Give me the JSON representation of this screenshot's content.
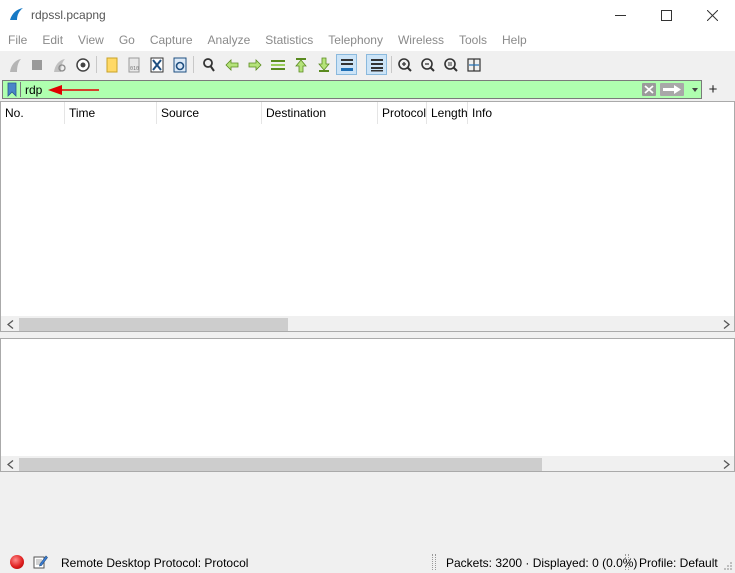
{
  "window": {
    "title": "rdpssl.pcapng",
    "minimize_icon": "minimize-icon",
    "maximize_icon": "maximize-icon",
    "close_icon": "close-icon"
  },
  "menu": {
    "items": [
      "File",
      "Edit",
      "View",
      "Go",
      "Capture",
      "Analyze",
      "Statistics",
      "Telephony",
      "Wireless",
      "Tools",
      "Help"
    ]
  },
  "toolbar": {
    "icons": [
      "start-capture-icon",
      "stop-capture-icon",
      "restart-capture-icon",
      "capture-options-icon",
      "open-file-icon",
      "save-file-icon",
      "close-file-icon",
      "reload-file-icon",
      "find-packet-icon",
      "go-back-icon",
      "go-forward-icon",
      "go-to-packet-icon",
      "go-first-icon",
      "go-last-icon",
      "autoscroll-icon",
      "colorize-icon",
      "zoom-in-icon",
      "zoom-out-icon",
      "normal-size-icon",
      "resize-columns-icon"
    ]
  },
  "filter": {
    "value": "rdp",
    "background_color": "#afffaf",
    "bookmark_icon": "bookmark-icon",
    "clear_icon": "clear-filter-icon",
    "apply_icon": "apply-filter-arrow-icon",
    "dropdown_icon": "chevron-down-icon",
    "add_label": "+"
  },
  "annotation": {
    "arrow_color": "#e00000"
  },
  "packet_list": {
    "columns": [
      "No.",
      "Time",
      "Source",
      "Destination",
      "Protocol",
      "Length",
      "Info"
    ],
    "rows": []
  },
  "statusbar": {
    "protocol_text": "Remote Desktop Protocol: Protocol",
    "packets_text": "Packets: 3200 · Displayed: 0 (0.0%)",
    "profile_text": "Profile: Default"
  }
}
